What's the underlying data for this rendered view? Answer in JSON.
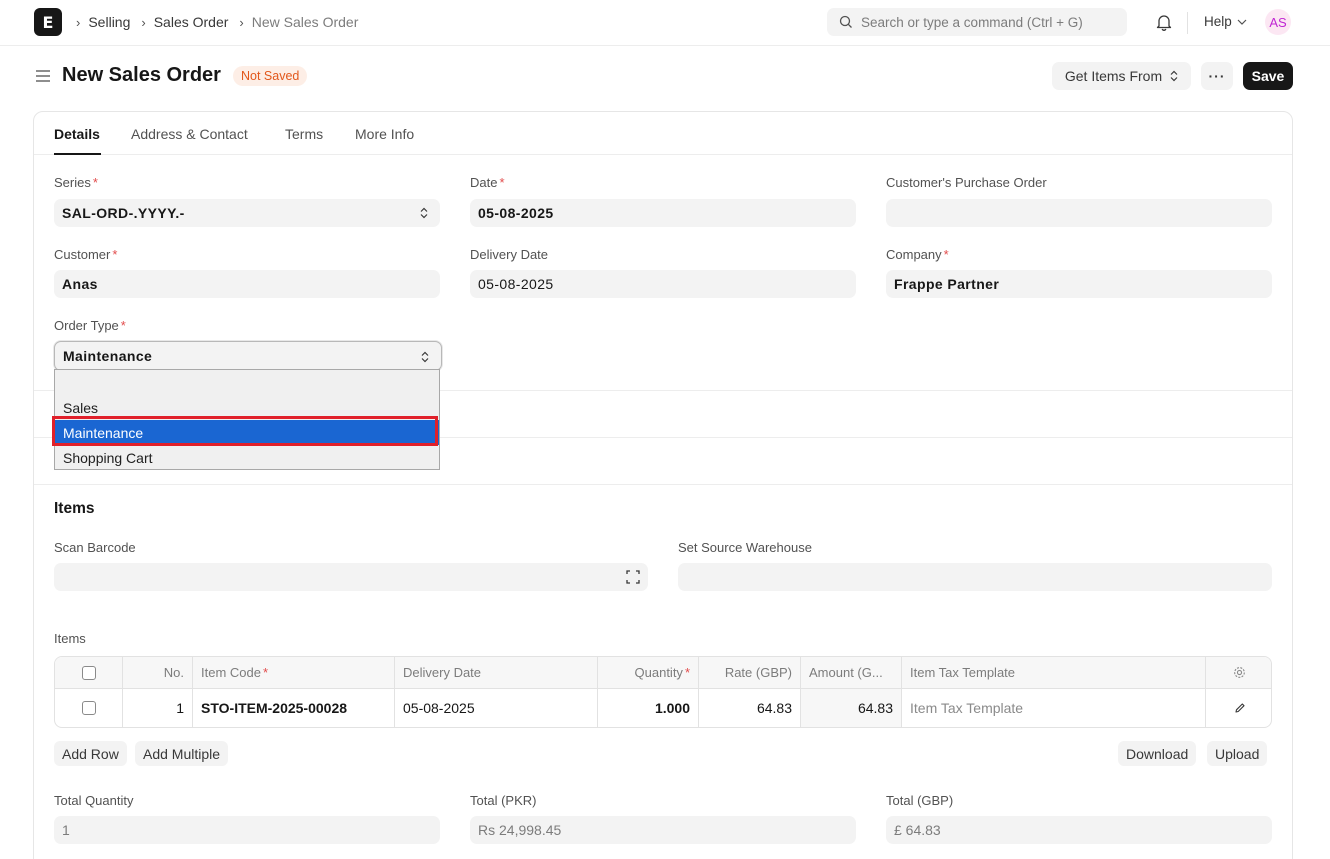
{
  "navbar": {
    "logo": "E",
    "breadcrumbs": [
      "Selling",
      "Sales Order",
      "New Sales Order"
    ],
    "search_placeholder": "Search or type a command (Ctrl + G)",
    "help_label": "Help",
    "avatar_initials": "AS"
  },
  "header": {
    "title": "New Sales Order",
    "status_badge": "Not Saved",
    "get_items_label": "Get Items From",
    "more_label": "···",
    "save_label": "Save"
  },
  "tabs": [
    "Details",
    "Address & Contact",
    "Terms",
    "More Info"
  ],
  "fields": {
    "series": {
      "label": "Series",
      "value": "SAL-ORD-.YYYY.-"
    },
    "date": {
      "label": "Date",
      "value": "05-08-2025"
    },
    "customer_po": {
      "label": "Customer's Purchase Order",
      "value": ""
    },
    "customer": {
      "label": "Customer",
      "value": "Anas"
    },
    "delivery_date": {
      "label": "Delivery Date",
      "value": "05-08-2025"
    },
    "company": {
      "label": "Company",
      "value": "Frappe Partner"
    },
    "order_type": {
      "label": "Order Type",
      "value": "Maintenance"
    }
  },
  "order_type_options": [
    "",
    "Sales",
    "Maintenance",
    "Shopping Cart"
  ],
  "order_type_selected": "Maintenance",
  "items_section": {
    "title": "Items",
    "scan_barcode_label": "Scan Barcode",
    "source_warehouse_label": "Set Source Warehouse",
    "table_label": "Items",
    "columns": [
      "No.",
      "Item Code",
      "Delivery Date",
      "Quantity",
      "Rate (GBP)",
      "Amount (G...",
      "Item Tax Template"
    ],
    "rows": [
      {
        "no": "1",
        "item_code": "STO-ITEM-2025-00028",
        "delivery_date": "05-08-2025",
        "quantity": "1.000",
        "rate": "64.83",
        "amount": "64.83",
        "item_tax_template": "Item Tax Template"
      }
    ],
    "add_row_label": "Add Row",
    "add_multiple_label": "Add Multiple",
    "download_label": "Download",
    "upload_label": "Upload"
  },
  "totals": {
    "total_quantity": {
      "label": "Total Quantity",
      "value": "1"
    },
    "total_pkr": {
      "label": "Total (PKR)",
      "value": "Rs 24,998.45"
    },
    "total_gbp": {
      "label": "Total (GBP)",
      "value": "£ 64.83"
    }
  },
  "colors": {
    "accent_dark": "#171717",
    "badge_bg": "#fdeee6",
    "badge_text": "#e2571b",
    "required": "#e24c4c",
    "selected_option": "#1a66d2",
    "highlight_outline": "#e0202a"
  }
}
